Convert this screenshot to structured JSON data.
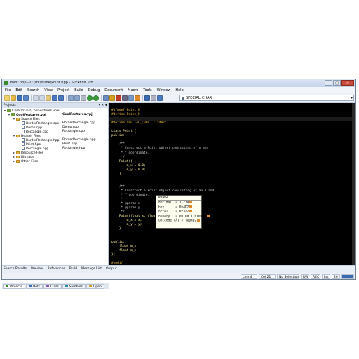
{
  "window": {
    "title": "Point.hpp - C:\\src\\trunk\\Point.hpp - SlickEdit Pro"
  },
  "menu": [
    "File",
    "Edit",
    "Search",
    "View",
    "Project",
    "Build",
    "Debug",
    "Document",
    "Macro",
    "Tools",
    "Window",
    "Help"
  ],
  "toolbar": {
    "symbol_combo": "SPECIAL_CHAR"
  },
  "projects": {
    "header": "Projects",
    "controls": "▾ × ◂",
    "workspace": "C:\\src\\trunk\\CoolFeatures.vpw",
    "project": "CoolFeatures.vpj",
    "project_right": "CoolFeatures.vpj",
    "source_folder": "Source Files",
    "source_files": [
      "BorderRectangle.cpp",
      "Demo.cpp",
      "Rectangle.cpp"
    ],
    "source_files_right": [
      "BorderRectangle.cpp",
      "Demo.cpp",
      "Rectangle.cpp"
    ],
    "header_folder": "Header Files",
    "header_files": [
      "BorderRectangle.hpp",
      "Point.hpp",
      "Rectangle.hpp"
    ],
    "header_files_right": [
      "BorderRectangle.hpp",
      "Point.hpp",
      "Rectangle.hpp"
    ],
    "other_folders": [
      "Resource Files",
      "Bitmaps",
      "Other Files"
    ]
  },
  "side_tabs": [
    "Projects",
    "Defs",
    "Class",
    "Symbols",
    "Open"
  ],
  "editor": {
    "lines": [
      "#ifndef Point_H",
      "#define Point_H",
      "",
      "#define SPECIAL_CHAR  '\\x402'",
      "",
      "class Point {",
      "public:",
      "",
      "    /**",
      "     * Construct a Point object consisting of x and",
      "     * Y coordinate.",
      "     */",
      "    Point() :",
      "        m_x = 0.0;",
      "        m_y = 0.0;",
      "    }",
      "",
      "",
      "    /**",
      "     * Construct a Point object consisting of an X and",
      "     * Y coordinate.",
      "     *",
      "     * @param x",
      "     * @param y",
      "     */",
      "    Point(float x, float y) {",
      "        m_x = x;",
      "        m_y = y;",
      "    }",
      "",
      "",
      "public:",
      "    float m_x;",
      "    float m_y;",
      "};",
      "",
      "#endif"
    ]
  },
  "popup": {
    "header": "0x402",
    "rows": [
      {
        "label": "decimal",
        "value": "= 1,234"
      },
      {
        "label": "hex",
        "value": "= 0x4D2"
      },
      {
        "label": "octal",
        "value": "= 02322"
      },
      {
        "label": "binary",
        "value": "= 0b100 11010010"
      },
      {
        "label": "unicode (Ā)",
        "value": "= \\u04D2"
      }
    ]
  },
  "bottom_tabs": [
    "Search Results",
    "Preview",
    "References",
    "Build",
    "Message List",
    "Output"
  ],
  "status": {
    "line": "Line 4",
    "col": "Col 21",
    "selection": "No Selection",
    "rw": "RW",
    "rec": "REC",
    "ins": "Ins",
    "num": "20"
  },
  "colors": {
    "editor_bg": "#000000",
    "preprocessor": "#f0c040",
    "accent": "#3a8a2a"
  }
}
